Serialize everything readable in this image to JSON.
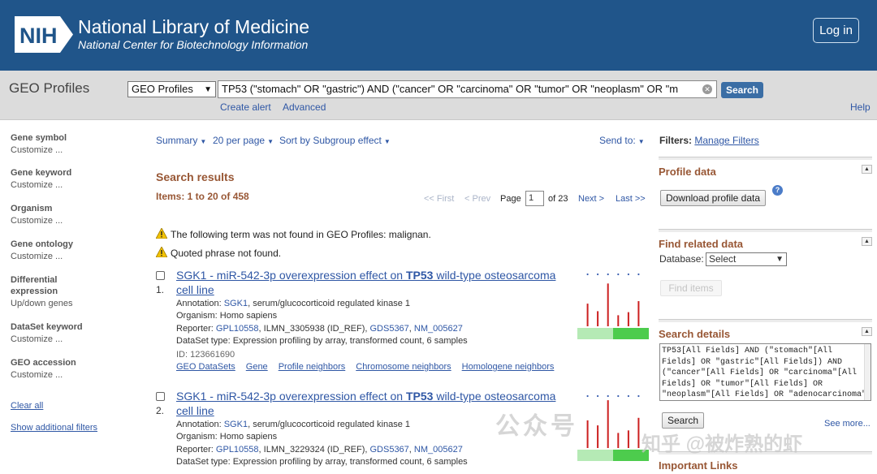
{
  "header": {
    "logo_text": "NIH",
    "title": "National Library of Medicine",
    "subtitle": "National Center for Biotechnology Information",
    "login_label": "Log in",
    "bg_color": "#20558a"
  },
  "search": {
    "db_name": "GEO Profiles",
    "db_select_value": "GEO Profiles",
    "query": "TP53 (\"stomach\" OR \"gastric\") AND (\"cancer\" OR \"carcinoma\" OR \"tumor\" OR \"neoplasm\" OR \"m",
    "search_label": "Search",
    "create_alert": "Create alert",
    "advanced": "Advanced",
    "help": "Help"
  },
  "sidebar": {
    "items": [
      {
        "title": "Gene symbol",
        "sub": "Customize ..."
      },
      {
        "title": "Gene keyword",
        "sub": "Customize ..."
      },
      {
        "title": "Organism",
        "sub": "Customize ..."
      },
      {
        "title": "Gene ontology",
        "sub": "Customize ..."
      },
      {
        "title": "Differential",
        "title2": "expression",
        "sub": "Up/down genes"
      },
      {
        "title": "DataSet keyword",
        "sub": "Customize ..."
      },
      {
        "title": "GEO accession",
        "sub": "Customize ..."
      }
    ],
    "clear_all": "Clear all",
    "show_filters": "Show additional filters"
  },
  "toolbar": {
    "summary": "Summary",
    "per_page": "20 per page",
    "sort": "Sort by Subgroup effect",
    "send_to": "Send to:"
  },
  "results": {
    "title": "Search results",
    "items_label": "Items: 1 to 20 of 458",
    "pager": {
      "first": "<< First",
      "prev": "< Prev",
      "page_label": "Page",
      "page_value": "1",
      "of_label": "of 23",
      "next": "Next >",
      "last": "Last >>"
    },
    "warnings": [
      "The following term was not found in GEO Profiles: malignan.",
      "Quoted phrase not found."
    ],
    "list": [
      {
        "num": "1.",
        "title_a": "SGK1 - miR-542-3p overexpression effect on ",
        "title_b": "TP53",
        "title_c": " wild-type osteosarcoma cell line",
        "annotation_label": "Annotation: ",
        "annotation_gene": "SGK1",
        "annotation_rest": ", serum/glucocorticoid regulated kinase 1",
        "organism": "Organism: Homo sapiens",
        "reporter_label": "Reporter: ",
        "reporter_gpl": "GPL10558",
        "reporter_mid": ", ILMN_3305938 (ID_REF), ",
        "reporter_gds": "GDS5367",
        "reporter_sep": ", ",
        "reporter_nm": "NM_005627",
        "dataset_type": "DataSet type: Expression profiling by array, transformed count, 6 samples",
        "id": "ID: 123661690",
        "links": [
          "GEO DataSets",
          "Gene",
          "Profile neighbors",
          "Chromosome neighbors",
          "Homologene neighbors"
        ],
        "bars": [
          0.45,
          0.3,
          0.85,
          0.22,
          0.28,
          0.5
        ]
      },
      {
        "num": "2.",
        "title_a": "SGK1 - miR-542-3p overexpression effect on ",
        "title_b": "TP53",
        "title_c": " wild-type osteosarcoma cell line",
        "annotation_label": "Annotation: ",
        "annotation_gene": "SGK1",
        "annotation_rest": ", serum/glucocorticoid regulated kinase 1",
        "organism": "Organism: Homo sapiens",
        "reporter_label": "Reporter: ",
        "reporter_gpl": "GPL10558",
        "reporter_mid": ", ILMN_3229324 (ID_REF), ",
        "reporter_gds": "GDS5367",
        "reporter_sep": ", ",
        "reporter_nm": "NM_005627",
        "dataset_type": "DataSet type: Expression profiling by array, transformed count, 6 samples",
        "bars": [
          0.55,
          0.45,
          0.95,
          0.3,
          0.35,
          0.6
        ]
      }
    ]
  },
  "right": {
    "filters_label": "Filters:",
    "manage_filters": "Manage Filters",
    "profile_data_title": "Profile data",
    "download_label": "Download profile data",
    "find_related_title": "Find related data",
    "database_label": "Database:",
    "database_value": "Select",
    "find_items": "Find items",
    "search_details_title": "Search details",
    "search_details_text": "TP53[All Fields] AND (\"stomach\"[All Fields] OR \"gastric\"[All Fields]) AND (\"cancer\"[All Fields] OR \"carcinoma\"[All Fields] OR \"tumor\"[All Fields] OR \"neoplasm\"[All Fields] OR \"adenocarcinoma\"[All Fields])",
    "search_btn": "Search",
    "see_more": "See more...",
    "important_links": "Important Links"
  },
  "watermark": {
    "line1": "公众号",
    "line2": "知乎 @被炸熟的虾"
  }
}
